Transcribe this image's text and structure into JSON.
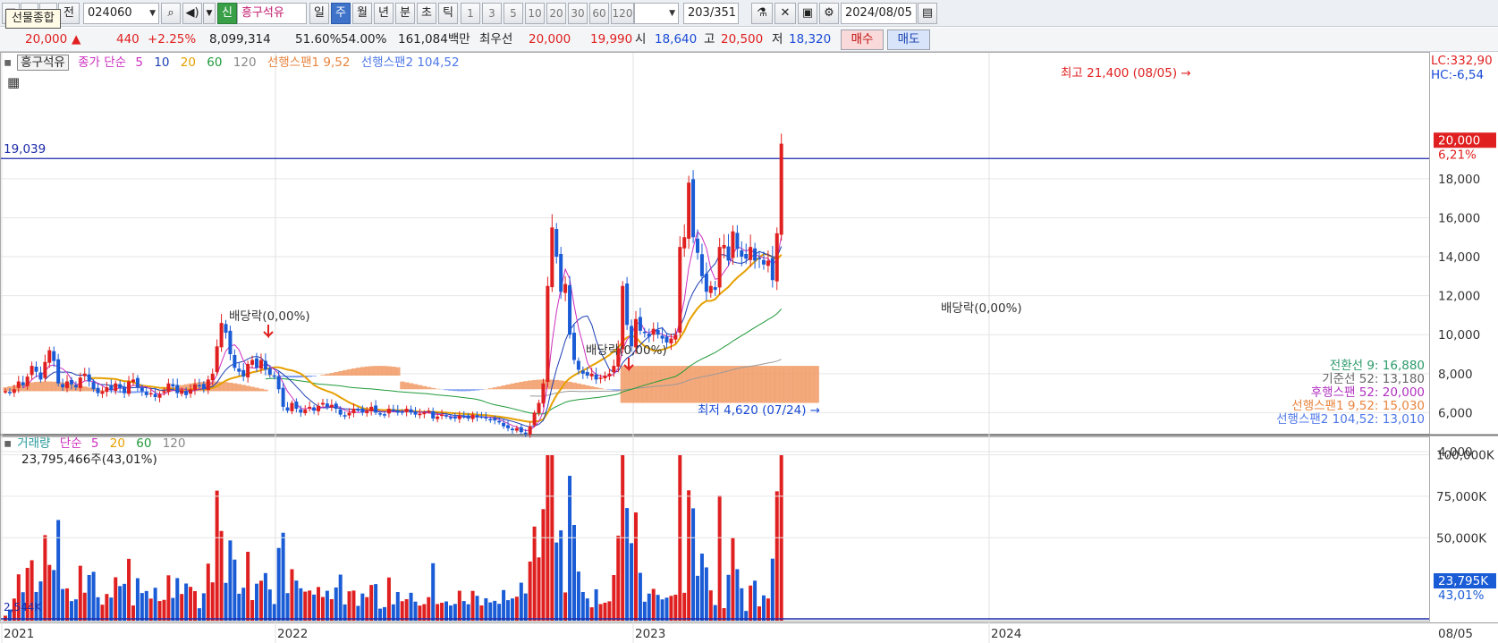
{
  "toolbar": {
    "tooltip": "선물종합",
    "code": "024060",
    "tag_new": "신",
    "stock_name": "흥구석유",
    "periods": [
      "일",
      "주",
      "월",
      "년",
      "분",
      "초",
      "틱"
    ],
    "active_period": "주",
    "intervals": [
      "1",
      "3",
      "5",
      "10",
      "20",
      "30",
      "60",
      "120"
    ],
    "count": "203",
    "total": "/351",
    "date": "2024/08/05",
    "btn_jeon": "전"
  },
  "quote": {
    "price": "20,000",
    "arrow": "▲",
    "change": "440",
    "change_pct": "+2.25%",
    "volume": "8,099,314",
    "ratio1": "51.60%",
    "ratio2": "54.00%",
    "amount": "161,084백만",
    "priority_label": "최우선",
    "ask": "20,000",
    "bid": "19,990",
    "open_label": "시",
    "open": "18,640",
    "high_label": "고",
    "high": "20,500",
    "low_label": "저",
    "low": "18,320",
    "buy": "매수",
    "sell": "매도"
  },
  "colors": {
    "up": "#e02020",
    "down": "#1a5bd6",
    "ma5": "#cc2fbf",
    "ma10": "#1c3fb3",
    "ma20": "#e6a000",
    "ma60": "#1f9a3a",
    "ma120": "#9a9a9a",
    "span1": "#f19a64",
    "span2": "#6b8ff0",
    "hline": "#1c2aa8",
    "conversion": "#2a9a6a"
  },
  "chart_data": [
    {
      "type": "candlestick",
      "legend": {
        "name": "흥구석유",
        "ma_label": "종가 단순",
        "ma_periods": [
          "5",
          "10",
          "20",
          "60",
          "120"
        ],
        "span1_label": "선행스팬1 9,52",
        "span2_label": "선행스팬2 104,52"
      },
      "ylim": [
        4000,
        23500
      ],
      "y_ticks": [
        "4,000",
        "6,000",
        "8,000",
        "10,000",
        "12,000",
        "14,000",
        "16,000",
        "18,000"
      ],
      "x_ticks": [
        "2021",
        "2022",
        "2023",
        "2024"
      ],
      "x_end_label": "08/05",
      "lc_label": "LC:332,90",
      "hc_label": "HC:-6,54",
      "horizontal_line": {
        "value": 19039,
        "label": "19,039"
      },
      "current_price": {
        "value": 20000,
        "label": "20,000",
        "pct": "6,21%"
      },
      "annotations": {
        "high": "최고 21,400 (08/05)",
        "low": "최저 4,620 (07/24)",
        "dividends": [
          "배당락(0,00%)",
          "배당락(0,00%)",
          "배당락(0,00%)"
        ]
      },
      "ichimoku": {
        "conversion": "전환선 9: 16,880",
        "base": "기준선 52: 13,180",
        "lagging": "후행스팬 52: 20,000",
        "span1": "선행스팬1 9,52: 15,030",
        "span2": "선행스팬2 104,52: 13,010"
      },
      "series": [
        {
          "name": "종가",
          "close": [
            7100,
            7050,
            7200,
            7600,
            7400,
            7850,
            8400,
            8100,
            7700,
            8600,
            9200,
            8650,
            7500,
            7300,
            7600,
            7450,
            7300,
            7800,
            8000,
            7600,
            7200,
            7000,
            7100,
            7300,
            7150,
            7500,
            7250,
            7000,
            7600,
            7700,
            7300,
            7100,
            6900,
            7000,
            6800,
            6950,
            7100,
            7500,
            7350,
            7000,
            7150,
            6900,
            7200,
            7450,
            7400,
            7200,
            7700,
            8000,
            9400,
            10600,
            10100,
            9000,
            8300,
            8100,
            7850,
            8500,
            8700,
            8300,
            8700,
            8200,
            7950,
            7900,
            7200,
            6300,
            6100,
            6500,
            6200,
            6000,
            6150,
            6300,
            6100,
            6350,
            6500,
            6300,
            6400,
            6200,
            5900,
            5800,
            6000,
            6200,
            6150,
            6000,
            6100,
            6300,
            6000,
            5950,
            5900,
            6200,
            6150,
            6000,
            6050,
            6200,
            6000,
            5900,
            5950,
            6000,
            6100,
            5700,
            5800,
            5900,
            5800,
            5750,
            5700,
            5850,
            5800,
            5700,
            5900,
            5750,
            5800,
            5700,
            5650,
            5600,
            5500,
            5300,
            5200,
            5100,
            5200,
            5000,
            4900,
            5300,
            6000,
            6500,
            7500,
            12500,
            15500,
            14000,
            12200,
            12600,
            10000,
            8700,
            8200,
            8000,
            7900,
            8000,
            7700,
            7800,
            7900,
            8000,
            8400,
            9300,
            12500,
            10500,
            9400,
            10800,
            10200,
            10100,
            9900,
            10300,
            10000,
            9800,
            9600,
            9800,
            10000,
            14500,
            15000,
            17800,
            15000,
            14200,
            13000,
            12200,
            12500,
            12300,
            14500,
            14600,
            13800,
            15300,
            14400,
            14000,
            13900,
            14500,
            13800,
            13900,
            13600,
            13800,
            12800,
            15200,
            19800
          ]
        },
        {
          "name": "거래량",
          "unit": "K",
          "ylim": [
            0,
            110000
          ],
          "y_ticks": [
            "50,000K",
            "75,000K",
            "100,000K"
          ],
          "label": "23,795,466주(43,01%)",
          "current": "23,795K",
          "current_pct": "43,01%",
          "left_label": "2,544K"
        }
      ],
      "volume_legend": {
        "name": "거래량",
        "ma_label": "단순",
        "ma_periods": [
          "5",
          "20",
          "60",
          "120"
        ]
      }
    }
  ]
}
